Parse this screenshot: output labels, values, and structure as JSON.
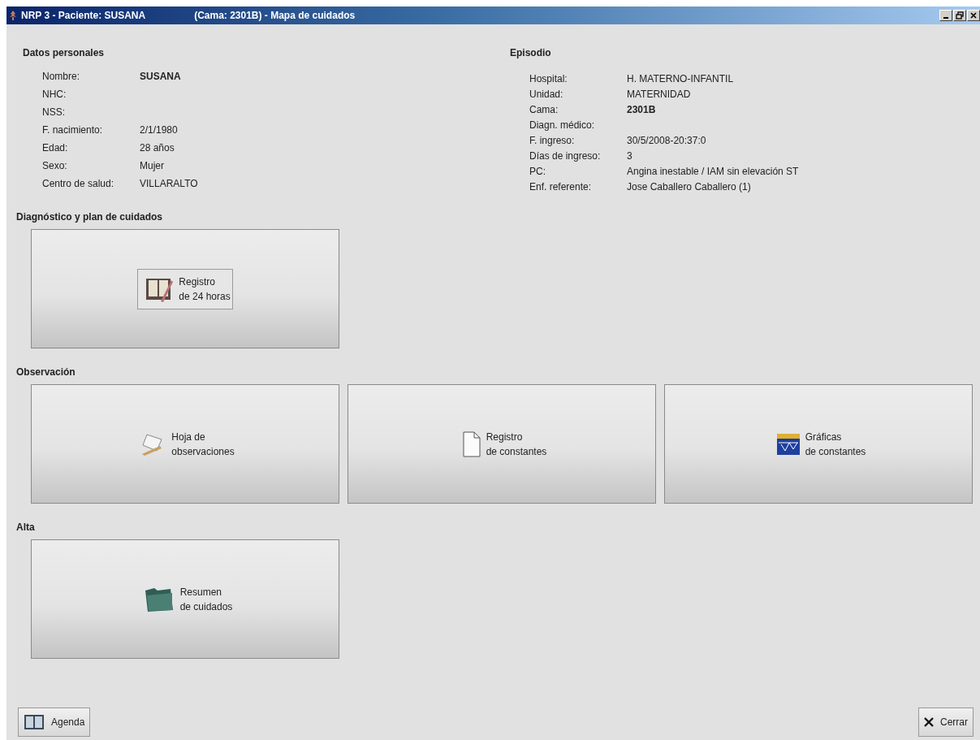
{
  "window": {
    "title": "NRP 3 - Paciente: SUSANA",
    "subtitle": "(Cama: 2301B) - Mapa de cuidados",
    "controls": [
      {
        "kind": "minimize"
      },
      {
        "kind": "restore"
      },
      {
        "kind": "close"
      }
    ]
  },
  "personal": {
    "heading": "Datos personales",
    "fields": [
      {
        "label": "Nombre:",
        "value": "SUSANA",
        "bold": true
      },
      {
        "label": "NHC:"
      },
      {
        "label": "NSS:"
      },
      {
        "label": "F. nacimiento:",
        "value": "2/1/1980",
        "bold": false
      },
      {
        "label": "Edad:",
        "value": "28 años",
        "bold": false
      },
      {
        "label": "Sexo:",
        "value": "Mujer",
        "bold": false
      },
      {
        "label": "Centro de salud:",
        "value": "VILLARALTO",
        "bold": false
      }
    ]
  },
  "episode": {
    "heading": "Episodio",
    "fields": [
      {
        "label": "Hospital:",
        "value": "H. MATERNO-INFANTIL",
        "bold": false
      },
      {
        "label": "Unidad:",
        "value": "MATERNIDAD",
        "bold": false
      },
      {
        "label": "Cama:",
        "value": "2301B",
        "bold": true
      },
      {
        "label": "Diagn. médico:"
      },
      {
        "label": "F. ingreso:",
        "value": "30/5/2008-20:37:0",
        "bold": false
      },
      {
        "label": "Días de ingreso:",
        "value": "3",
        "bold": false
      },
      {
        "label": "PC:",
        "value": "Angina inestable / IAM sin elevación ST",
        "bold": false
      },
      {
        "label": "Enf. referente:",
        "value": "Jose Caballero Caballero (1)",
        "bold": false
      }
    ]
  },
  "sections": [
    {
      "heading": "Diagnóstico y plan de cuidados",
      "tiles": [
        {
          "kind": "journal",
          "framed": true,
          "lines": [
            "Registro",
            "de 24 horas"
          ]
        }
      ]
    },
    {
      "heading": "Observación",
      "tiles": [
        {
          "kind": "notepad",
          "framed": false,
          "lines": [
            "Hoja de",
            "observaciones"
          ]
        },
        {
          "kind": "document",
          "framed": false,
          "lines": [
            "Registro",
            "de constantes"
          ]
        },
        {
          "kind": "graph",
          "framed": false,
          "lines": [
            "Gráficas",
            "de constantes"
          ]
        }
      ]
    },
    {
      "heading": "Alta",
      "tiles": [
        {
          "kind": "folder",
          "framed": false,
          "lines": [
            "Resumen",
            "de cuidados"
          ]
        }
      ]
    }
  ],
  "footer": {
    "left": {
      "kind": "agenda",
      "label": "Agenda"
    },
    "right": {
      "kind": "close",
      "label": "Cerrar"
    }
  }
}
